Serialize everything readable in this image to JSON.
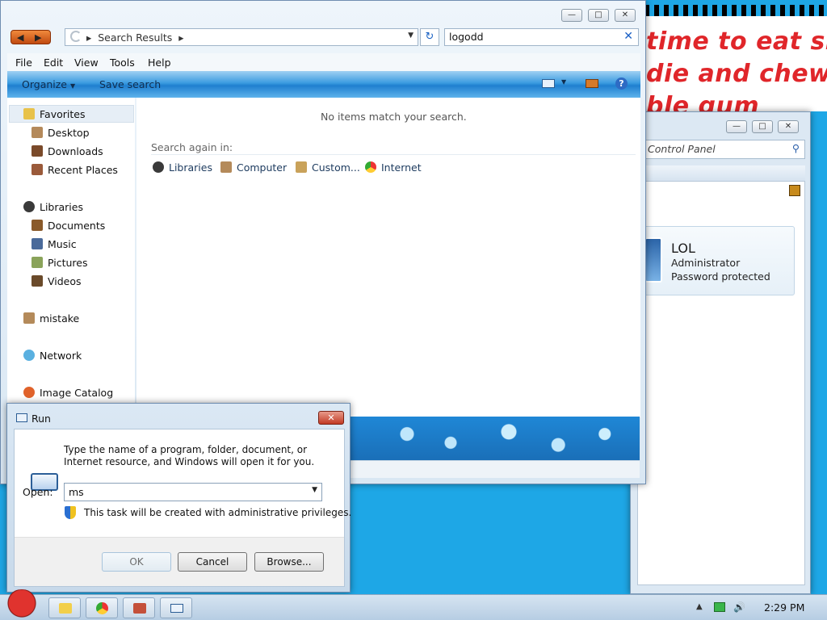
{
  "wallpaper": {
    "lines": [
      "time to eat shit",
      "die and chew",
      "ble gum"
    ]
  },
  "control_panel": {
    "search_placeholder": "Control Panel",
    "user": {
      "name": "LOL",
      "role": "Administrator",
      "status": "Password protected"
    }
  },
  "explorer": {
    "address": {
      "breadcrumb": "Search Results"
    },
    "search": {
      "value": "logodd",
      "clear_icon": "close-icon"
    },
    "menu": [
      "File",
      "Edit",
      "View",
      "Tools",
      "Help"
    ],
    "commands": {
      "organize": "Organize",
      "save_search": "Save search"
    },
    "nav": {
      "favorites": "Favorites",
      "favorites_items": [
        "Desktop",
        "Downloads",
        "Recent Places"
      ],
      "libraries": "Libraries",
      "libraries_items": [
        "Documents",
        "Music",
        "Pictures",
        "Videos"
      ],
      "mistake": "mistake",
      "network": "Network",
      "image_catalog": "Image Catalog"
    },
    "content": {
      "no_items": "No items match your search.",
      "search_again_label": "Search again in:",
      "search_again_items": [
        "Libraries",
        "Computer",
        "Custom...",
        "Internet"
      ]
    }
  },
  "run_dialog": {
    "title": "Run",
    "description": "Type the name of a program, folder, document, or Internet resource, and Windows will open it for you.",
    "open_label": "Open:",
    "open_value": "ms",
    "admin_note": "This task will be created with administrative privileges.",
    "buttons": {
      "ok": "OK",
      "cancel": "Cancel",
      "browse": "Browse..."
    }
  },
  "taskbar": {
    "clock": "2:29 PM"
  }
}
